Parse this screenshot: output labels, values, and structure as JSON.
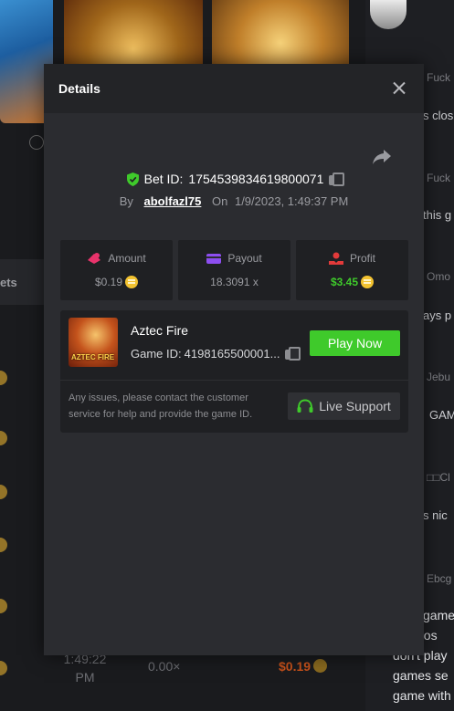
{
  "background": {
    "tab_label": "ets",
    "row": {
      "time": "1:49:22 PM",
      "multiplier": "0.00×",
      "amount": "$0.19"
    }
  },
  "chat": {
    "messages": [
      {
        "name": "Fuck",
        "text": "s clos"
      },
      {
        "name": "Fuck",
        "text": "this g"
      },
      {
        "name": "Omo",
        "text": "ays p"
      },
      {
        "name": "Jebu",
        "text": "GAM"
      },
      {
        "name": "□□Cl",
        "text": "s nic"
      },
      {
        "name": "Ebcg",
        "text": ""
      }
    ],
    "last_message_lines": [
      "game",
      "a los",
      "don't play",
      "games se",
      "game with"
    ]
  },
  "modal": {
    "title": "Details",
    "bet_id_label": "Bet ID:",
    "bet_id": "1754539834619800071",
    "by_label": "By",
    "username": "abolfazl75",
    "on_label": "On",
    "timestamp": "1/9/2023, 1:49:37 PM",
    "stats": {
      "amount": {
        "label": "Amount",
        "value": "$0.19"
      },
      "payout": {
        "label": "Payout",
        "value": "18.3091 x"
      },
      "profit": {
        "label": "Profit",
        "value": "$3.45"
      }
    },
    "game": {
      "name": "Aztec Fire",
      "thumb_text": "AZTEC FIRE",
      "id_label": "Game ID:",
      "id_value": "4198165500001...",
      "play_label": "Play Now"
    },
    "notice": "Any issues, please contact the customer service for help and provide the game ID.",
    "support_label": "Live Support"
  },
  "colors": {
    "accent_green": "#3fca2b",
    "coin_gold": "#f2c230",
    "amount_icon": "#e8336b",
    "payout_icon": "#8d4ef0",
    "profit_icon": "#e23a3a"
  }
}
